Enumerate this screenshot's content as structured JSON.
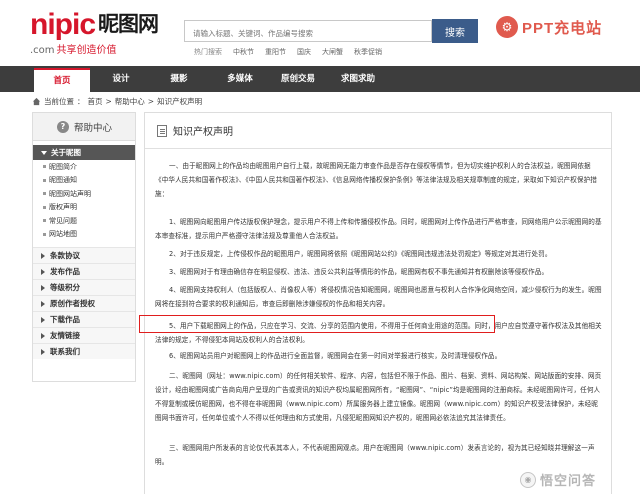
{
  "header": {
    "logo_en": "nipic",
    "logo_cn": "昵图网",
    "logo_domain": ".com",
    "logo_slogan": "共享创造价值",
    "search_placeholder": "请输入标题、关键词、作品编号搜索",
    "search_button": "搜索",
    "hot_label": "热门搜索",
    "hot_terms": [
      "中秋节",
      "重阳节",
      "国庆",
      "大闸蟹",
      "秋季促销"
    ],
    "watermark_top": "PPT充电站"
  },
  "nav": {
    "items": [
      {
        "label": "首页",
        "active": true
      },
      {
        "label": "设计",
        "active": false
      },
      {
        "label": "摄影",
        "active": false
      },
      {
        "label": "多媒体",
        "active": false
      },
      {
        "label": "原创交易",
        "active": false
      },
      {
        "label": "求图求助",
        "active": false
      }
    ]
  },
  "breadcrumb": {
    "prefix": "当前位置",
    "items": [
      "首页",
      "帮助中心",
      "知识产权声明"
    ],
    "sep": ">"
  },
  "sidebar": {
    "title": "帮助中心",
    "about_label": "关于昵图",
    "about_items": [
      "昵图简介",
      "昵图通知",
      "昵图网站声明",
      "版权声明",
      "常见问题",
      "网站地图"
    ],
    "sections": [
      "条款协议",
      "发布作品",
      "等级积分",
      "原创作者授权",
      "下载作品",
      "友情链接",
      "联系我们"
    ]
  },
  "main": {
    "title": "知识产权声明",
    "paragraphs": [
      "一、由于昵图网上的作品均由昵图用户自行上载，故昵图网无能力审查作品是否存在侵权等情节，但为切实维护权利人的合法权益，昵图网依据《中华人民共和国著作权法》、《中国人民共和国著作权法》、《信息网络传播权保护条例》等法律法规及相关规章制度的规定，采取如下知识产权保护措施：",
      "1、昵图网向昵图用户传达版权保护理念，提示用户不得上传和传播侵权作品。同时，昵图网对上传作品进行严格审查，同网络用户公示昵图网的基本审查标准，提示用户严格遵守法律法规及尊重他人合法权益。",
      "2、对于违反规定，上传侵权作品的昵图用户，昵图网将依照《昵图网站公约》《昵图网违规违法处罚规定》等规定对其进行处罚。",
      "3、昵图网对于有理由确信存在明显侵权、违法、违反公共利益等情形的作品，昵图网有权不事先通知并有权删除该等侵权作品。",
      "4、昵图网支持权利人（包括版权人、肖像权人等）将侵权情况告知昵图网，昵图网也愿意与权利人合作净化网络空间，减少侵权行为的发生。昵图网将在接到符合要求的权利通知后，审查后即删除涉嫌侵权的作品和相关内容。",
      "5、用户下载昵图网上的作品，只应在学习、交流、分享的范围内使用，不得用于任何商业用途的范围。同时，用户应自觉遵守著作权法及其他相关法律的规定，不得侵犯本网站及权利人的合法权利。",
      "6、昵图网站员用户对昵图网上的作品进行全面监督，昵图网会在第一时间对举报进行核实，及时清理侵权作品。",
      "二、昵图网（网址：www.nipic.com）的任何相关软件、程序、内容，包括但不限于作品、图片、档案、资料、网站构架、网站版面的安排、网页设计，经由昵图网或广告商向用户呈现的广告或资讯的知识产权均属昵图网所有，“昵图网”、“nipic”均是昵图网的注册商标。未经昵图网许可，任何人不得复制或模仿昵图网，也不得在非昵图网（www.nipic.com）所属服务器上建立镜像。昵图网（www.nipic.com）的知识产权受法律保护，未经昵图网书面许可，任何单位或个人不得以任何理由和方式使用，凡侵犯昵图网知识产权的，昵图网必依法追究其法律责任。",
      "三、昵图网用户所发表的言论仅代表其本人，不代表昵图网观点。用户在昵图网（www.nipic.com）发表言论的，视为其已经知晓并理解这一声明。"
    ]
  },
  "watermark_bottom": "悟空问答",
  "colors": {
    "brand_red": "#d6162b",
    "nav_bg": "#3d3d3d",
    "search_btn": "#3b5c8a",
    "highlight": "#e01e1e"
  }
}
